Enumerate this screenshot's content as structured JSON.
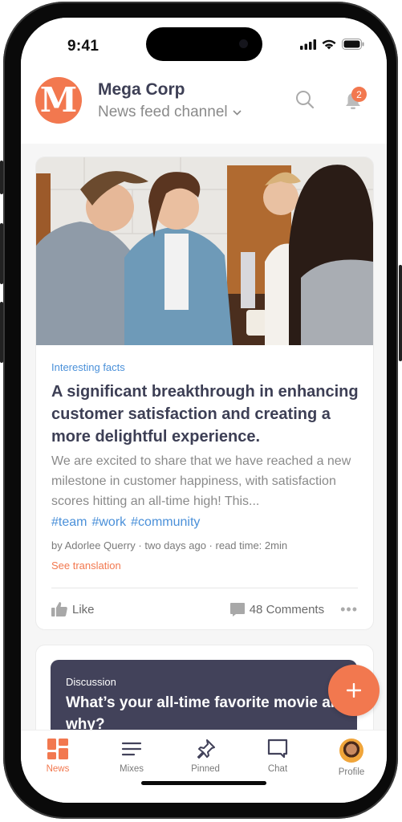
{
  "status_bar": {
    "time": "9:41"
  },
  "header": {
    "logo_letter": "M",
    "brand": "Mega Corp",
    "channel": "News feed channel",
    "notification_count": "2"
  },
  "posts": [
    {
      "image_alt": "Group of four colleagues smiling around a table with a tablet and coffee",
      "category": "Interesting facts",
      "title": "A significant breakthrough in enhancing customer satisfaction and creating a more delightful experience.",
      "excerpt": "We are excited to share that we have reached a new milestone in customer happiness, with satisfaction scores hitting an all-time high! This...",
      "tags": [
        "#team",
        "#work",
        "#community"
      ],
      "meta": "by Adorlee Querry · two days ago · read time: 2min",
      "translate_label": "See translation",
      "like_label": "Like",
      "comments_label": "48 Comments"
    },
    {
      "category": "Discussion",
      "title": "What’s your all-time favorite movie and why?"
    }
  ],
  "fab": {
    "label": "+"
  },
  "tabs": [
    {
      "label": "News",
      "icon": "grid-icon",
      "active": true
    },
    {
      "label": "Mixes",
      "icon": "lines-icon",
      "active": false
    },
    {
      "label": "Pinned",
      "icon": "pin-icon",
      "active": false
    },
    {
      "label": "Chat",
      "icon": "chat-icon",
      "active": false
    },
    {
      "label": "Profile",
      "icon": "avatar",
      "active": false
    }
  ],
  "colors": {
    "accent": "#f2784f",
    "link": "#4a90d9",
    "ink": "#3d3f55",
    "discussion_bg": "#42425a"
  }
}
